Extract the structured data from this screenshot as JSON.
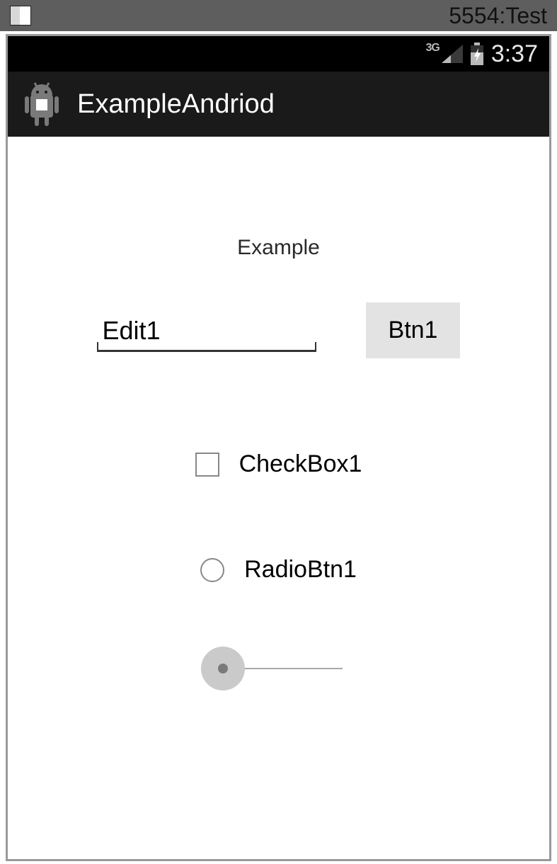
{
  "window": {
    "title": "5554:Test"
  },
  "status": {
    "network": "3G",
    "time": "3:37"
  },
  "actionbar": {
    "title": "ExampleAndriod"
  },
  "content": {
    "heading": "Example",
    "edit_value": "Edit1",
    "button_label": "Btn1",
    "checkbox_label": "CheckBox1",
    "radio_label": "RadioBtn1"
  }
}
